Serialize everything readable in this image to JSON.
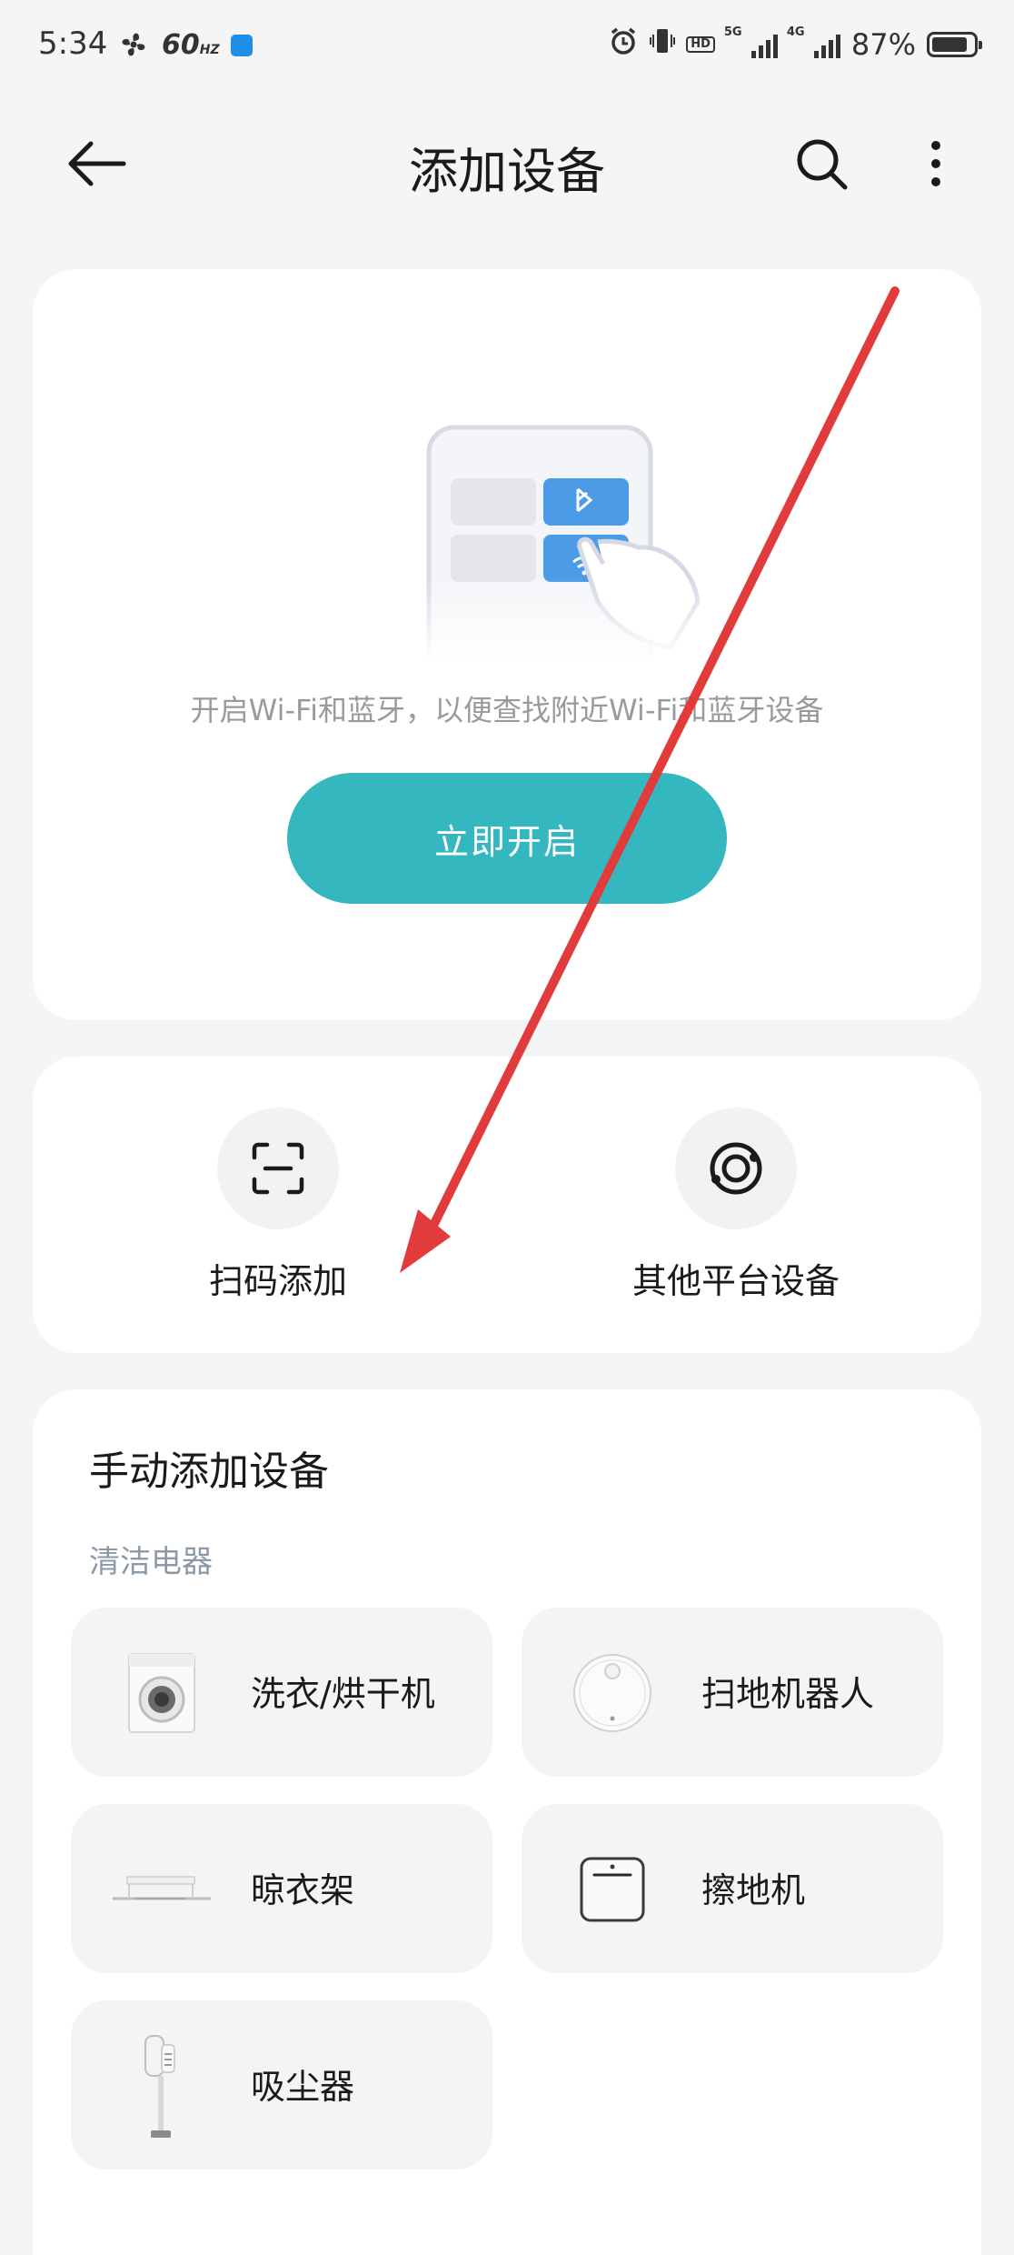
{
  "status_bar": {
    "time": "5:34",
    "refresh_rate": "60",
    "refresh_unit": "HZ",
    "hd_label": "HD",
    "signal1_label": "5G",
    "signal2_label": "4G",
    "battery": "87%"
  },
  "header": {
    "title": "添加设备"
  },
  "enable_card": {
    "hint": "开启Wi-Fi和蓝牙，以便查找附近Wi-Fi和蓝牙设备",
    "button_label": "立即开启"
  },
  "quick_actions": {
    "scan_label": "扫码添加",
    "other_label": "其他平台设备"
  },
  "manual": {
    "title": "手动添加设备",
    "category": "清洁电器",
    "devices": [
      {
        "label": "洗衣/烘干机",
        "icon": "washer-dryer-icon"
      },
      {
        "label": "扫地机器人",
        "icon": "robot-vacuum-icon"
      },
      {
        "label": "晾衣架",
        "icon": "drying-rack-icon"
      },
      {
        "label": "擦地机",
        "icon": "floor-mopper-icon"
      },
      {
        "label": "吸尘器",
        "icon": "vacuum-cleaner-icon"
      }
    ]
  },
  "colors": {
    "accent": "#35b7bf",
    "annotation_arrow": "#e23b3b",
    "background": "#f5f5f5"
  }
}
